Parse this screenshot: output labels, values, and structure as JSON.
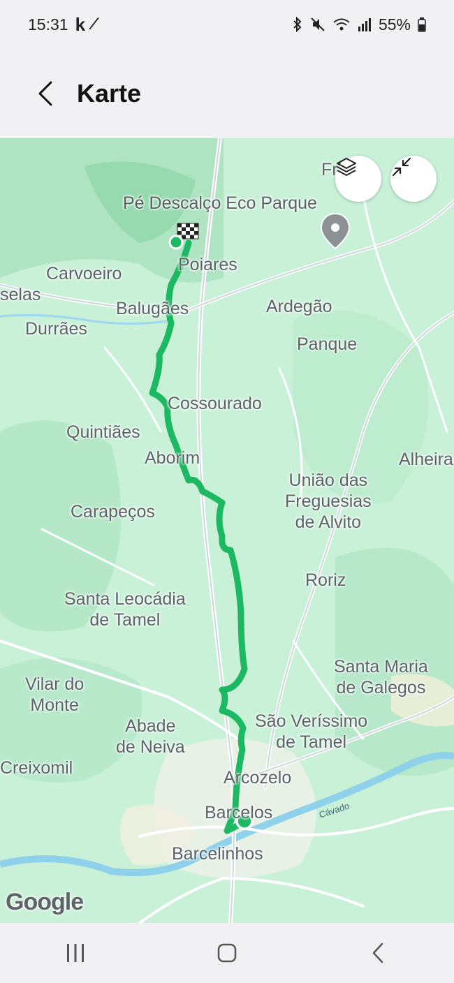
{
  "status_bar": {
    "time": "15:31",
    "notification_icons": [
      "k-icon",
      "z-icon"
    ],
    "system_icons": [
      "bluetooth-icon",
      "mute-icon",
      "wifi-icon",
      "signal-icon"
    ],
    "battery": "55%"
  },
  "app_bar": {
    "title": "Karte"
  },
  "map": {
    "buttons": [
      "layers-button",
      "minimize-button"
    ],
    "places": [
      {
        "id": "frielas",
        "label": "Fri...la"
      },
      {
        "id": "pe-descalco",
        "label": "Pé Descalço Eco Parque"
      },
      {
        "id": "carvoeiro",
        "label": "Carvoeiro"
      },
      {
        "id": "poiares",
        "label": "Poiares"
      },
      {
        "id": "selas",
        "label": "selas"
      },
      {
        "id": "balugaes",
        "label": "Balugães"
      },
      {
        "id": "ardegao",
        "label": "Ardegão"
      },
      {
        "id": "durraes",
        "label": "Durrães"
      },
      {
        "id": "panque",
        "label": "Panque"
      },
      {
        "id": "cossourado",
        "label": "Cossourado"
      },
      {
        "id": "quintiaes",
        "label": "Quintiães"
      },
      {
        "id": "aborim",
        "label": "Aborim"
      },
      {
        "id": "alheira",
        "label": "Alheira"
      },
      {
        "id": "uniao",
        "label": "União das\nFreguesias\nde Alvito"
      },
      {
        "id": "carapecos",
        "label": "Carapeços"
      },
      {
        "id": "roriz",
        "label": "Roriz"
      },
      {
        "id": "santa-leocadia",
        "label": "Santa Leocádia\nde Tamel"
      },
      {
        "id": "santa-maria",
        "label": "Santa Maria\nde Galegos"
      },
      {
        "id": "vilar-do-monte",
        "label": "Vilar do\nMonte"
      },
      {
        "id": "abade-de-neiva",
        "label": "Abade\nde Neiva"
      },
      {
        "id": "sao-verissimo",
        "label": "São Veríssimo\nde Tamel"
      },
      {
        "id": "creixomil",
        "label": "Creixomil"
      },
      {
        "id": "arcozelo",
        "label": "Arcozelo"
      },
      {
        "id": "barcelos",
        "label": "Barcelos"
      },
      {
        "id": "barcelinhos",
        "label": "Barcelinhos"
      },
      {
        "id": "cavado",
        "label": "Cávado"
      }
    ],
    "route_color": "#1db862",
    "attribution": "Google"
  },
  "nav_bar": {
    "buttons": [
      "recents-button",
      "home-button",
      "back-button"
    ]
  }
}
